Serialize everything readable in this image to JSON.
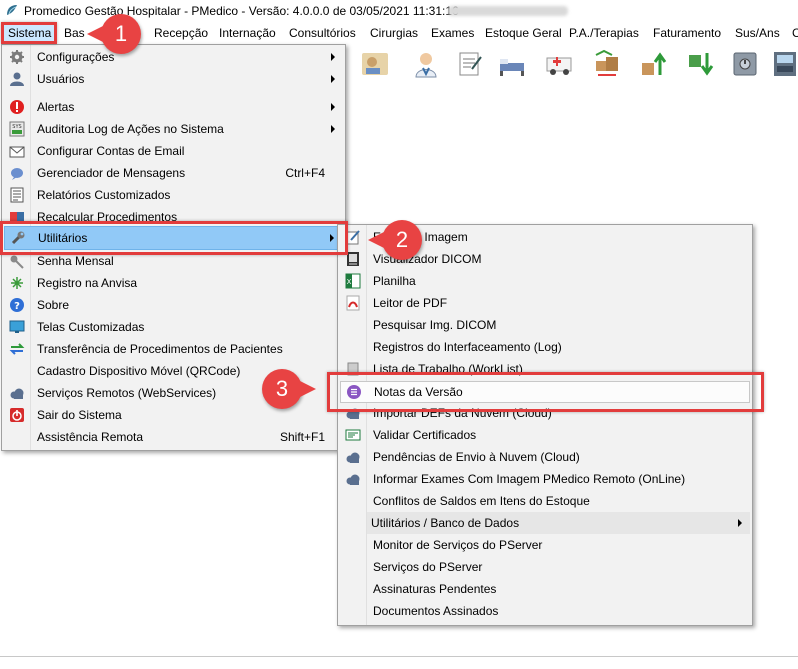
{
  "window": {
    "title": "Promedico Gestão Hospitalar - PMedico - Versão: 4.0.0.0 de 03/05/2021 11:31:16"
  },
  "menubar": [
    "Sistema",
    "Bas",
    "Recepção",
    "Internação",
    "Consultórios",
    "Cirurgias",
    "Exames",
    "Estoque Geral",
    "P.A./Terapias",
    "Faturamento",
    "Sus/Ans",
    "C"
  ],
  "sistema_menu": [
    {
      "label": "Configurações",
      "submenu": true,
      "icon": "gear-icon"
    },
    {
      "label": "Usuários",
      "submenu": true,
      "icon": "user-icon"
    },
    {
      "label": "Alertas",
      "submenu": true,
      "icon": "alert-icon"
    },
    {
      "label": "Auditoria Log de Ações no Sistema",
      "submenu": true,
      "icon": "log-icon"
    },
    {
      "label": "Configurar Contas de Email",
      "icon": "email-icon"
    },
    {
      "label": "Gerenciador de Mensagens",
      "shortcut": "Ctrl+F4",
      "icon": "message-icon"
    },
    {
      "label": "Relatórios Customizados",
      "icon": "report-icon"
    },
    {
      "label": "Recalcular Procedimentos",
      "icon": "recalc-icon"
    },
    {
      "label": "Utilitários",
      "submenu": true,
      "icon": "wrench-icon"
    },
    {
      "label": "Senha Mensal",
      "icon": "key-icon"
    },
    {
      "label": "Registro na Anvisa",
      "icon": "anvisa-icon"
    },
    {
      "label": "Sobre",
      "icon": "help-icon"
    },
    {
      "label": "Telas Customizadas",
      "icon": "monitor-icon"
    },
    {
      "label": "Transferência de Procedimentos de Pacientes",
      "icon": "transfer-icon"
    },
    {
      "label": "Cadastro Dispositivo Móvel (QRCode)",
      "icon": "qrcode-icon"
    },
    {
      "label": "Serviços Remotos (WebServices)",
      "icon": "cloud-icon"
    },
    {
      "label": "Sair do Sistema",
      "icon": "exit-icon"
    },
    {
      "label": "Assistência Remota",
      "shortcut": "Shift+F1",
      "icon": ""
    }
  ],
  "utilitarios_menu": [
    {
      "label": "Editor de Imagem",
      "icon": "image-editor-icon"
    },
    {
      "label": "Visualizador DICOM",
      "icon": "dicom-icon"
    },
    {
      "label": "Planilha",
      "icon": "spreadsheet-icon"
    },
    {
      "label": "Leitor de PDF",
      "icon": "pdf-icon"
    },
    {
      "label": "Pesquisar Img. DICOM",
      "icon": ""
    },
    {
      "label": "Registros do Interfaceamento (Log)",
      "icon": ""
    },
    {
      "label": "Lista de Trabalho (WorkList)",
      "icon": "worklist-icon"
    },
    {
      "label": "Notas da Versão",
      "icon": "notes-icon"
    },
    {
      "label": "Importar DEFs da Nuvem (Cloud)",
      "icon": "cloud-icon"
    },
    {
      "label": "Validar Certificados",
      "icon": "certificate-icon"
    },
    {
      "label": "Pendências de Envio à Nuvem (Cloud)",
      "icon": "cloud-icon"
    },
    {
      "label": "Informar Exames Com Imagem PMedico Remoto (OnLine)",
      "icon": "cloud-icon"
    },
    {
      "label": "Conflitos de Saldos em Itens do Estoque",
      "icon": ""
    },
    {
      "label": "Utilitários / Banco de Dados",
      "submenu": true,
      "icon": ""
    },
    {
      "label": "Monitor de Serviços do PServer",
      "icon": ""
    },
    {
      "label": "Serviços do PServer",
      "icon": ""
    },
    {
      "label": "Assinaturas Pendentes",
      "icon": ""
    },
    {
      "label": "Documentos Assinados",
      "icon": ""
    }
  ],
  "callouts": [
    "1",
    "2",
    "3"
  ],
  "colors": {
    "menu_bg": "#f2f2f2",
    "highlight": "#91c9f7",
    "callout": "#e84343"
  }
}
